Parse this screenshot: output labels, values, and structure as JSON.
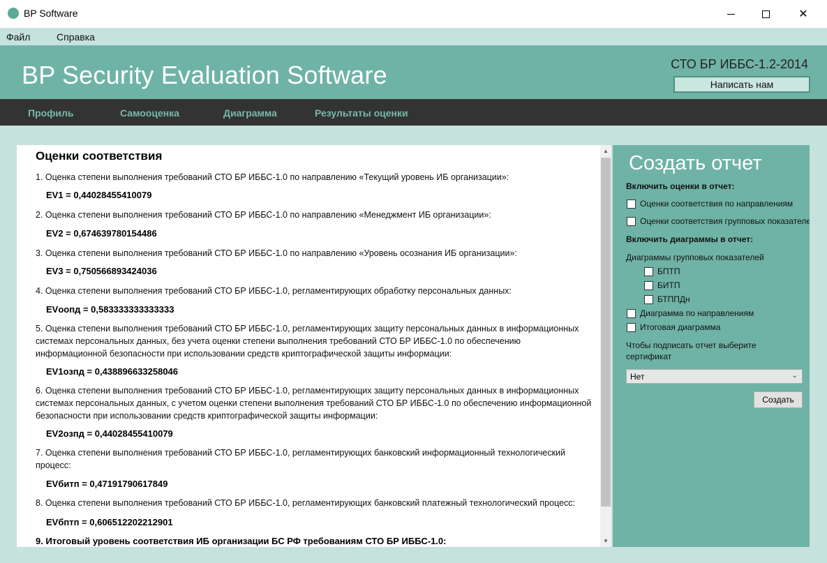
{
  "window": {
    "title": "BP Software",
    "minimize_icon": "minimize-icon",
    "maximize_icon": "maximize-icon",
    "close_icon": "close-icon",
    "close_glyph": "✕"
  },
  "menu": {
    "items": [
      "Файл",
      "Справка"
    ]
  },
  "header": {
    "app_title": "BP Security Evaluation Software",
    "standard": "СТО БР ИББС-1.2-2014",
    "contact_button": "Написать нам",
    "accent_color": "#6fb3a6"
  },
  "nav": {
    "tabs": [
      "Профиль",
      "Самооценка",
      "Диаграмма",
      "Результаты оценки"
    ]
  },
  "main": {
    "heading": "Оценки соответствия",
    "items": [
      {
        "desc": "1. Оценка степени выполнения требований СТО БР ИББС-1.0 по направлению «Текущий уровень ИБ организации»:",
        "value": "EV1 = 0,44028455410079"
      },
      {
        "desc": "2. Оценка степени выполнения требований СТО БР ИББС-1.0 по направлению «Менеджмент ИБ организации»:",
        "value": "EV2 = 0,674639780154486"
      },
      {
        "desc": "3. Оценка степени выполнения требований СТО БР ИББС-1.0 по направлению «Уровень осознания ИБ организации»:",
        "value": "EV3 = 0,750566893424036"
      },
      {
        "desc": "4. Оценка степени выполнения требований СТО БР ИББС-1.0, регламентирующих обработку персональных данных:",
        "value": "EVоопд = 0,583333333333333"
      },
      {
        "desc": "5. Оценка степени выполнения требований СТО БР ИББС-1.0, регламентирующих защиту персональных данных в информационных системах персональных данных, без учета оценки степени выполнения требований СТО БР ИББС-1.0 по обеспечению информационной безопасности при использовании средств криптографической защиты информации:",
        "value": "EV1озпд = 0,438896633258046"
      },
      {
        "desc": "6. Оценка степени выполнения требований СТО БР ИББС-1.0, регламентирующих защиту персональных данных в информационных системах персональных данных, с учетом оценки степени выполнения требований СТО БР ИББС-1.0 по обеспечению информационной безопасности при использовании средств криптографической защиты информации:",
        "value": "EV2озпд = 0,44028455410079"
      },
      {
        "desc": "7. Оценка степени выполнения требований СТО БР ИББС-1.0, регламентирующих банковский информационный технологический процесс:",
        "value": "EVбитп = 0,47191790617849"
      },
      {
        "desc": "8. Оценка степени выполнения требований СТО БР ИББС-1.0, регламентирующих банковский платежный технологический процесс:",
        "value": "EVбптп = 0,606512202212901"
      }
    ],
    "final": "9. Итоговый уровень соответствия ИБ организации БС РФ требованиям СТО БР ИББС-1.0:"
  },
  "report": {
    "title": "Создать отчет",
    "include_scores_label": "Включить оценки в отчет:",
    "score_options": [
      "Оценки соответствия по направлениям",
      "Оценки соответствия групповых показателей"
    ],
    "include_charts_label": "Включить диаграммы в отчет:",
    "group_charts_label": "Диаграммы групповых показателей",
    "group_chart_options": [
      "БПТП",
      "БИТП",
      "БТППДн"
    ],
    "chart_options": [
      "Диаграмма по направлениям",
      "Итоговая диаграмма"
    ],
    "certificate_label_1": "Чтобы подписать отчет выберите",
    "certificate_label_2": "сертификат",
    "certificate_value": "Нет",
    "create_button": "Создать"
  }
}
